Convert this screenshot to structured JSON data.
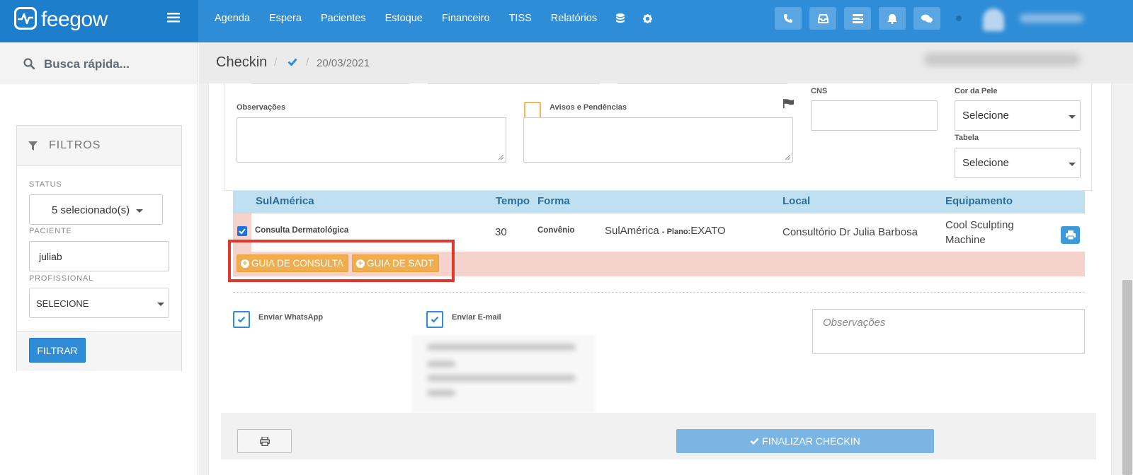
{
  "app": {
    "brand": "feegow"
  },
  "nav": {
    "items": [
      "Agenda",
      "Espera",
      "Pacientes",
      "Estoque",
      "Financeiro",
      "TISS",
      "Relatórios"
    ]
  },
  "search": {
    "placeholder": "Busca rápida..."
  },
  "breadcrumb": {
    "title": "Checkin",
    "date": "20/03/2021"
  },
  "filters": {
    "title": "FILTROS",
    "status_label": "STATUS",
    "status_value": "5 selecionado(s)",
    "paciente_label": "PACIENTE",
    "paciente_value": "juliab",
    "profissional_label": "PROFISSIONAL",
    "profissional_value": "SELECIONE",
    "button": "FILTRAR"
  },
  "form": {
    "observacoes_label": "Observações",
    "avisos_label": "Avisos e Pendências",
    "cns_label": "CNS",
    "cor_pele_label": "Cor da Pele",
    "cor_pele_value": "Selecione",
    "tabela_label": "Tabela",
    "tabela_value": "Selecione"
  },
  "table": {
    "headers": {
      "insurer": "SulAmérica",
      "tempo": "Tempo",
      "forma": "Forma",
      "local": "Local",
      "equipamento": "Equipamento"
    },
    "row": {
      "procedure": "Consulta Dermatológica",
      "tempo": "30",
      "forma": "Convênio",
      "convenio": "SulAmérica",
      "plano_prefix": "- Plano:",
      "plano": "EXATO",
      "local": "Consultório Dr Julia Barbosa",
      "equipamento_l1": "Cool Sculpting",
      "equipamento_l2": "Machine"
    },
    "buttons": {
      "guia_consulta": "GUIA DE CONSULTA",
      "guia_sadt": "GUIA DE SADT"
    }
  },
  "notify": {
    "whatsapp_label": "Enviar WhatsApp",
    "email_label": "Enviar E-mail",
    "obs_placeholder": "Observações"
  },
  "footer": {
    "finalizar": "FINALIZAR CHECKIN"
  },
  "colors": {
    "primary": "#2f8dd7",
    "warning": "#f0ad4e",
    "highlight": "#e2372d",
    "table_header": "#bfe0f0",
    "row_alert": "#f6d2cc"
  }
}
